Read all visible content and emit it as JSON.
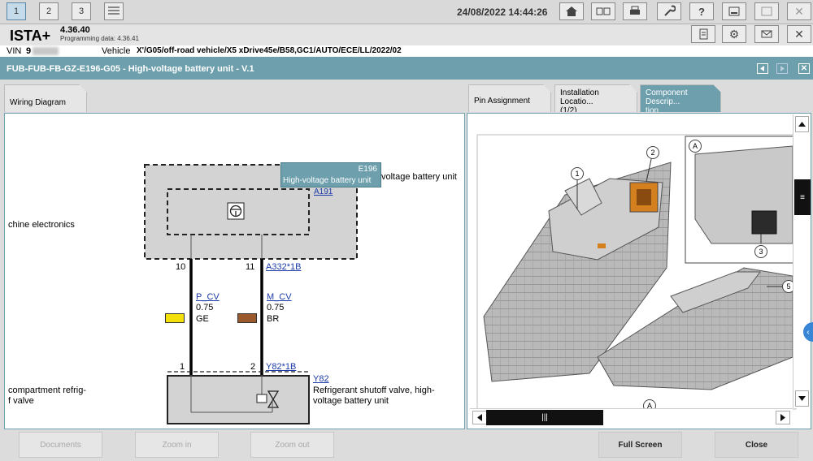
{
  "topbar": {
    "tabs": [
      "1",
      "2",
      "3"
    ],
    "datetime": "24/08/2022 14:44:26"
  },
  "app": {
    "name": "ISTA+",
    "version": "4.36.40",
    "programming_data": "Programming data:  4.36.41"
  },
  "vehicle": {
    "vin_label": "VIN",
    "vin_value": "9",
    "vehicle_label": "Vehicle",
    "vehicle_value": "X'/G05/off-road vehicle/X5 xDrive45e/B58,GC1/AUTO/ECE/LL/2022/02"
  },
  "title": "FUB-FUB-FB-GZ-E196-G05 - High-voltage battery unit - V.1",
  "tabs": {
    "wiring": "Wiring Diagram",
    "pin": "Pin Assignment",
    "install_1": "Installation Locatio...",
    "install_2": "(1/2)",
    "component_1": "Component Descrip...",
    "component_2": "tion"
  },
  "diagram": {
    "tooltip_code": "E196",
    "tooltip_name": "High-voltage battery unit",
    "upper_desc": "voltage battery unit",
    "upper_ref": "A191",
    "left_upper": "chine electronics",
    "pin_left_top": "10",
    "pin_right_top": "11",
    "connector_top": "A332*1B",
    "wire_left_name": "P_CV",
    "wire_left_size": "0.75",
    "wire_left_color": "GE",
    "wire_right_name": "M_CV",
    "wire_right_size": "0.75",
    "wire_right_color": "BR",
    "pin_left_bottom": "1",
    "pin_right_bottom": "2",
    "connector_bottom": "Y82*1B",
    "lower_ref": "Y82",
    "lower_desc_1": "Refrigerant shutoff valve, high-",
    "lower_desc_2": "voltage battery unit",
    "left_lower_1": "compartment refrig-",
    "left_lower_2": "f valve",
    "yellow": "#f5e10a",
    "brown": "#9b5a2c"
  },
  "photo": {
    "callouts": [
      "1",
      "2",
      "A",
      "3",
      "5",
      "A"
    ]
  },
  "buttons": {
    "documents": "Documents",
    "zoom_in": "Zoom in",
    "zoom_out": "Zoom out",
    "full_screen": "Full Screen",
    "close": "Close"
  },
  "colors": {
    "accent": "#6d9fad"
  }
}
